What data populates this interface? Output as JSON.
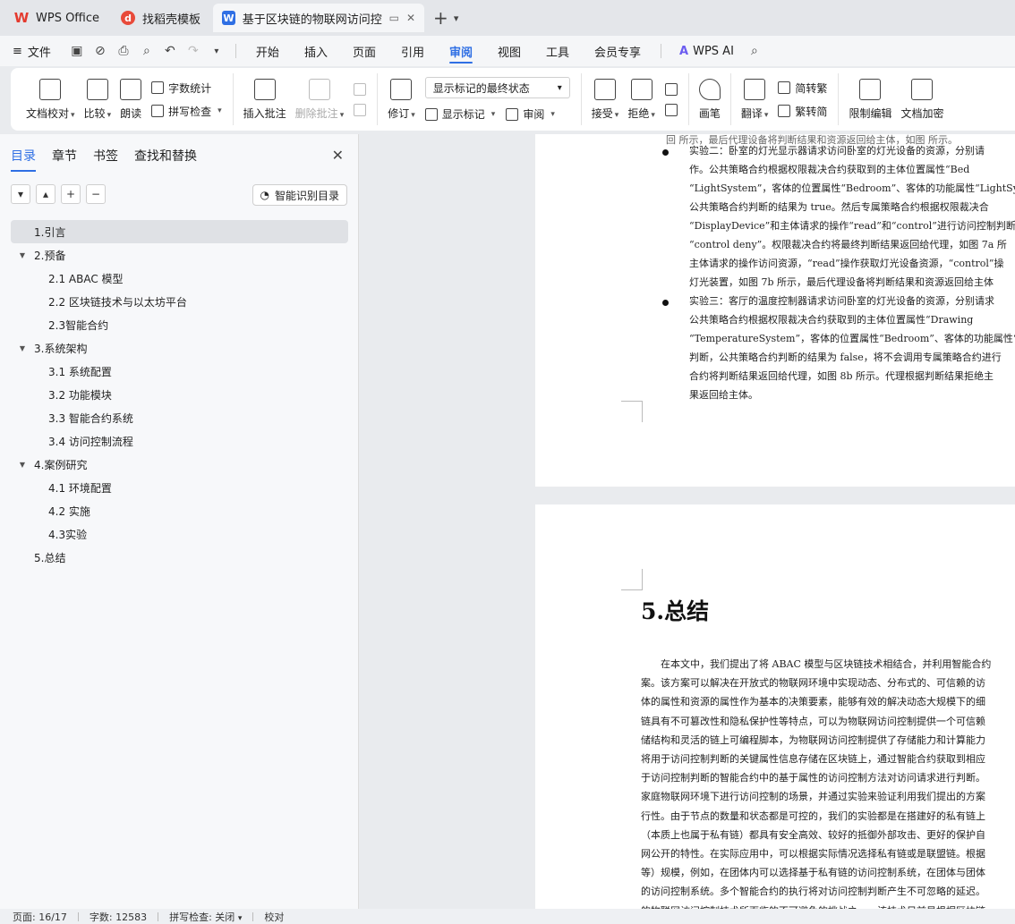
{
  "tabs": [
    {
      "label": "WPS Office",
      "logo": "wps-logo-icon"
    },
    {
      "label": "找稻壳模板",
      "logo": "daoke-logo-icon"
    },
    {
      "label": "基于区块链的物联网访问控制",
      "logo": "writer-logo-icon"
    }
  ],
  "menu": {
    "file": "文件",
    "items": [
      "开始",
      "插入",
      "页面",
      "引用",
      "审阅",
      "视图",
      "工具",
      "会员专享"
    ],
    "active": "审阅",
    "ai": "WPS AI"
  },
  "ribbon": {
    "doc_proof": "文档校对",
    "compare": "比较",
    "read_aloud": "朗读",
    "word_count": "字数统计",
    "spell_check": "拼写检查",
    "insert_comment": "插入批注",
    "delete_comment": "删除批注",
    "revise": "修订",
    "markup_select": "显示标记的最终状态",
    "show_markup": "显示标记",
    "review": "审阅",
    "accept": "接受",
    "reject": "拒绝",
    "pen": "画笔",
    "translate": "翻译",
    "to_traditional": "简转繁",
    "to_simplified": "繁转简",
    "restrict_edit": "限制编辑",
    "doc_encrypt": "文档加密"
  },
  "nav": {
    "tabs": [
      "目录",
      "章节",
      "书签",
      "查找和替换"
    ],
    "active_tab": "目录",
    "smart_button": "智能识别目录",
    "toc": [
      {
        "label": "1.引言",
        "level": 1,
        "expander": "",
        "selected": true
      },
      {
        "label": "2.预备",
        "level": 1,
        "expander": "▼",
        "selected": false
      },
      {
        "label": "2.1 ABAC 模型",
        "level": 2,
        "expander": "",
        "selected": false
      },
      {
        "label": "2.2  区块链技术与以太坊平台",
        "level": 2,
        "expander": "",
        "selected": false
      },
      {
        "label": "2.3智能合约",
        "level": 2,
        "expander": "",
        "selected": false
      },
      {
        "label": "3.系统架构",
        "level": 1,
        "expander": "▼",
        "selected": false
      },
      {
        "label": "3.1  系统配置",
        "level": 2,
        "expander": "",
        "selected": false
      },
      {
        "label": "3.2  功能模块",
        "level": 2,
        "expander": "",
        "selected": false
      },
      {
        "label": "3.3  智能合约系统",
        "level": 2,
        "expander": "",
        "selected": false
      },
      {
        "label": "3.4  访问控制流程",
        "level": 2,
        "expander": "",
        "selected": false
      },
      {
        "label": "4.案例研究",
        "level": 1,
        "expander": "▼",
        "selected": false
      },
      {
        "label": "4.1 环境配置",
        "level": 2,
        "expander": "",
        "selected": false
      },
      {
        "label": "4.2  实施",
        "level": 2,
        "expander": "",
        "selected": false
      },
      {
        "label": "4.3实验",
        "level": 2,
        "expander": "",
        "selected": false
      },
      {
        "label": "5.总结",
        "level": 1,
        "expander": "",
        "selected": false
      }
    ]
  },
  "doc": {
    "page1_top_line": "回   所示，最后代理设备将判断结果和资源返回给主体，如图   所示。",
    "exp2": [
      "实验二：卧室的灯光显示器请求访问卧室的灯光设备的资源，分别请",
      "作。公共策略合约根据权限裁决合约获取到的主体位置属性“Bed",
      "“LightSystem”，客体的位置属性“Bedroom”、客体的功能属性“LightSys",
      "公共策略合约判断的结果为 true。然后专属策略合约根据权限裁决合",
      "“DisplayDevice”和主体请求的操作“read”和“control”进行访问控制判断",
      "“control deny”。权限裁决合约将最终判断结果返回给代理，如图 7a 所",
      "主体请求的操作访问资源，“read”操作获取灯光设备资源，“control”操",
      "灯光装置，如图 7b 所示，最后代理设备将判断结果和资源返回给主体"
    ],
    "exp3": [
      "实验三：客厅的温度控制器请求访问卧室的灯光设备的资源，分别请求",
      "公共策略合约根据权限裁决合约获取到的主体位置属性“Drawing",
      "“TemperatureSystem”，客体的位置属性“Bedroom”、客体的功能属性“L",
      "判断，公共策略合约判断的结果为 false，将不会调用专属策略合约进行",
      "合约将判断结果返回给代理，如图 8b 所示。代理根据判断结果拒绝主",
      "果返回给主体。"
    ],
    "section_title": "5.总结",
    "summary": [
      "在本文中，我们提出了将 ABAC 模型与区块链技术相结合，并利用智能合约",
      "案。该方案可以解决在开放式的物联网环境中实现动态、分布式的、可信赖的访",
      "体的属性和资源的属性作为基本的决策要素，能够有效的解决动态大规模下的细",
      "链具有不可篡改性和隐私保护性等特点，可以为物联网访问控制提供一个可信赖",
      "储结构和灵活的链上可编程脚本，为物联网访问控制提供了存储能力和计算能力",
      "将用于访问控制判断的关键属性信息存储在区块链上，通过智能合约获取到相应",
      "于访问控制判断的智能合约中的基于属性的访问控制方法对访问请求进行判断。",
      "家庭物联网环境下进行访问控制的场景，并通过实验来验证利用我们提出的方案",
      "行性。由于节点的数量和状态都是可控的，我们的实验都是在搭建好的私有链上",
      "（本质上也属于私有链）都具有安全高效、较好的抵御外部攻击、更好的保护自",
      "网公开的特性。在实际应用中，可以根据实际情况选择私有链或是联盟链。根据",
      "等）规模，例如，在团体内可以选择基于私有链的访问控制系统，在团体与团体",
      "的访问控制系统。多个智能合约的执行将对访问控制判断产生不可忽略的延迟。",
      "的物联网访问控制技术所面临的不可避免的挑战之一。该技术目前是根据区块链"
    ]
  },
  "status": {
    "page": "页面: 16/17",
    "words": "字数: 12583",
    "spell": "拼写检查: 关闭",
    "proof": "校对"
  },
  "colors": {
    "accent": "#2f6fe4",
    "wps_red": "#e43a2e"
  }
}
